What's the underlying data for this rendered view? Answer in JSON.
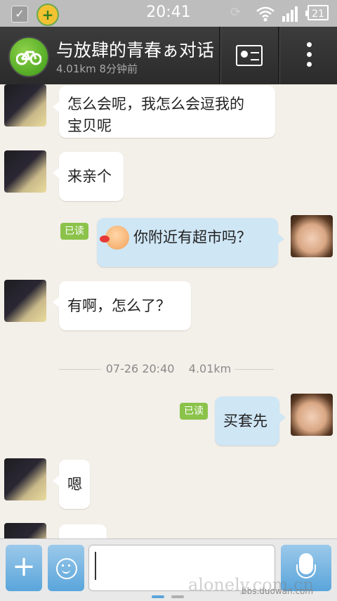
{
  "status_bar": {
    "time": "20:41",
    "battery": "21",
    "icons": [
      "checkbox-icon",
      "360-security-icon",
      "sync-icon",
      "wifi-icon",
      "signal-icon",
      "battery-icon"
    ]
  },
  "header": {
    "title": "与放肆的青春ぁ对话",
    "subtitle": "4.01km 8分钟前",
    "avatar_icon": "bicycle-icon",
    "accent": "#4caf1e"
  },
  "messages": [
    {
      "side": "left",
      "text_lines": [
        "怎么会呢，我怎么会逗我的",
        "宝贝呢"
      ]
    },
    {
      "side": "left",
      "text_lines": [
        "来亲个"
      ]
    },
    {
      "side": "right",
      "read": "已读",
      "emoji": "blush-face-emoji",
      "text_lines": [
        "你附近有超市吗？"
      ]
    },
    {
      "side": "left",
      "text_lines": [
        "有啊，怎么了？"
      ]
    },
    {
      "type": "separator",
      "time": "07-26 20:40",
      "distance": "4.01km"
    },
    {
      "side": "right",
      "read": "已读",
      "text_lines": [
        "买套先"
      ]
    },
    {
      "side": "left",
      "text_lines": [
        "嗯"
      ]
    }
  ],
  "input_bar": {
    "plus_label": "+",
    "text_value": "",
    "page_dots": 2,
    "accent": "#5aa5db"
  },
  "watermarks": [
    "alonely.com.cn",
    "bbs.duowan.com"
  ]
}
